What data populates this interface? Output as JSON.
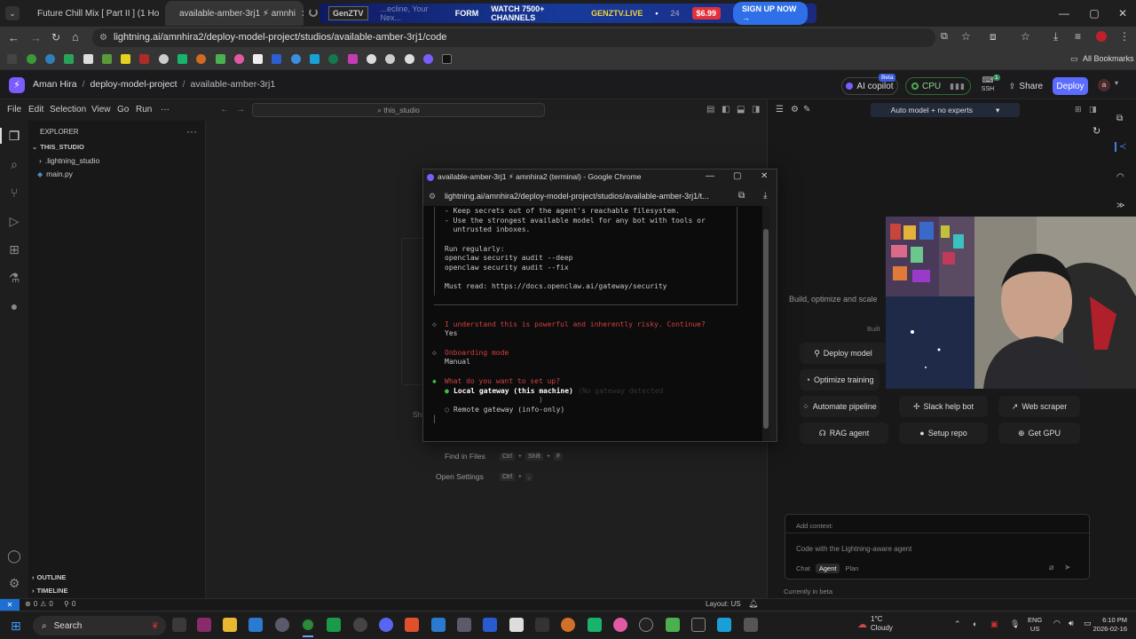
{
  "browser": {
    "tabs": [
      {
        "title": "Future Chill Mix [ Part II ] (1 Ho",
        "icon": "youtube-icon",
        "color": "#ff0000"
      },
      {
        "title": "available-amber-3rj1 ⚡ amnhi",
        "icon": "lightning-icon",
        "color": "#7b5cff"
      },
      {
        "title": "",
        "icon": "loading-icon",
        "color": "#888888"
      }
    ],
    "ad": {
      "brand": "GenZTV",
      "partial": "...ecline, Your Nex...",
      "platform": "FORM",
      "headline": "WATCH 7500+ CHANNELS",
      "site": "GENZTV.LIVE",
      "dot": "•",
      "extra": "24",
      "price": "$6.99",
      "cta": "SIGN UP NOW →"
    },
    "url": "lightning.ai/amnhira2/deploy-model-project/studios/available-amber-3rj1/code",
    "all_bookmarks": "All Bookmarks"
  },
  "app": {
    "breadcrumb": {
      "user": "Aman Hira",
      "sep": "/",
      "project": "deploy-model-project",
      "studio": "available-amber-3rj1"
    },
    "ai_copilot": "AI copilot",
    "beta": "Beta",
    "cpu": "CPU",
    "ssh": "SSH",
    "ssh_count": "1",
    "share": "Share",
    "deploy": "Deploy",
    "avatar": "a"
  },
  "menubar": {
    "items": [
      "File",
      "Edit",
      "Selection",
      "View",
      "Go",
      "Run",
      "···"
    ],
    "search": "this_studio"
  },
  "explorer": {
    "title": "EXPLORER",
    "more": "···",
    "root": "THIS_STUDIO",
    "items": [
      ".lightning_studio",
      "main.py"
    ],
    "outline": "OUTLINE",
    "timeline": "TIMELINE"
  },
  "editor": {
    "find_in_files": "Find in Files",
    "find_keys": [
      "Ctrl",
      "+",
      "Shift",
      "+",
      "F"
    ],
    "open_settings": "Open Settings",
    "settings_keys": [
      "Ctrl",
      "+",
      ","
    ],
    "show_partial": "Sh"
  },
  "right_panel": {
    "model_select": "Auto model + no experts",
    "build_text": "Build, optimize and scale",
    "built_text": "Built",
    "chips": [
      "Deploy model",
      "Optimize training",
      "Automate pipeline",
      "Slack help bot",
      "Web scraper",
      "RAG agent",
      "Setup repo",
      "Get GPU"
    ],
    "add_context": "Add context:",
    "input_placeholder": "Code with the Lightning-aware agent",
    "modes": [
      "Chat",
      "Agent",
      "Plan"
    ],
    "beta_note": "Currently in beta"
  },
  "status_bar": {
    "errors": "0",
    "warnings": "0",
    "ports": "0",
    "layout": "Layout: US"
  },
  "popup": {
    "title": "available-amber-3rj1 ⚡ amnhira2 (terminal) - Google Chrome",
    "url": "lightning.ai/amnhira2/deploy-model-project/studios/available-amber-3rj1/t...",
    "lines": [
      "- Keep secrets out of the agent's reachable filesystem.",
      "- Use the strongest available model for any bot with tools or",
      "  untrusted inboxes.",
      "",
      "Run regularly:",
      "openclaw security audit --deep",
      "openclaw security audit --fix",
      "",
      "Must read: https://docs.openclaw.ai/gateway/security"
    ],
    "q1": "I understand this is powerful and inherently risky. Continue?",
    "a1": "Yes",
    "q2": "Onboarding mode",
    "a2": "Manual",
    "q3": "What do you want to set up?",
    "opt1": "Local gateway (this machine)",
    "opt1_hint": "(No gateway detected",
    "opt1_hint2": ")",
    "opt2": "Remote gateway (info-only)"
  },
  "taskbar": {
    "search": "Search",
    "weather_temp": "1°C",
    "weather_desc": "Cloudy",
    "lang": "ENG",
    "region": "US",
    "time": "6:10 PM",
    "date": "2026-02-16"
  }
}
